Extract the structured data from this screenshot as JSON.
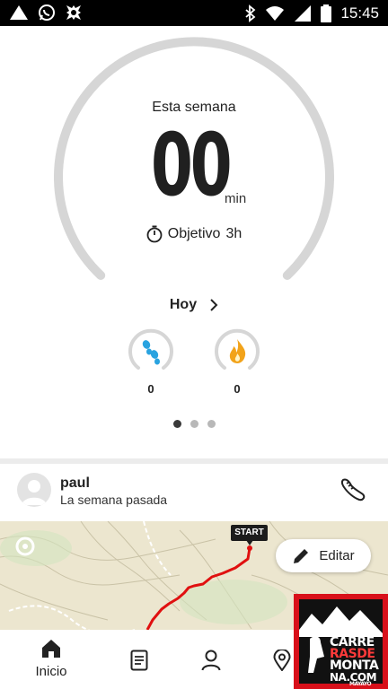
{
  "status_bar": {
    "time": "15:45",
    "left_icons": [
      "triangle-icon",
      "whatsapp-icon",
      "app-icon"
    ],
    "right_icons": [
      "bluetooth-icon",
      "wifi-icon",
      "signal-icon",
      "battery-icon"
    ]
  },
  "weekly": {
    "label": "Esta semana",
    "value": "00",
    "unit": "min",
    "goal_label": "Objetivo",
    "goal_value": "3h",
    "progress": 0
  },
  "today": {
    "label": "Hoy",
    "steps_value": "0",
    "calories_value": "0",
    "steps_icon": "footsteps-icon",
    "calories_icon": "flame-icon"
  },
  "pager": {
    "count": 3,
    "active": 0
  },
  "feed": {
    "user_name": "paul",
    "subtitle": "La semana pasada",
    "activity_icon": "running-shoe-icon"
  },
  "map": {
    "start_label": "START",
    "edit_label": "Editar"
  },
  "nav": {
    "home_label": "Inicio",
    "items": [
      "home-icon",
      "diary-icon",
      "profile-icon",
      "map-icon"
    ]
  },
  "watermark": {
    "line1": "CARRE",
    "line2": "RASDE",
    "line3": "MONTA",
    "line4": "NA.COM",
    "tagline": "MAYAYO"
  },
  "colors": {
    "accent_blue": "#29a3e0",
    "flame_orange": "#f2a31a",
    "route_red": "#e01010",
    "ring_gray": "#d6d6d6",
    "map_bg": "#ece6cf"
  }
}
